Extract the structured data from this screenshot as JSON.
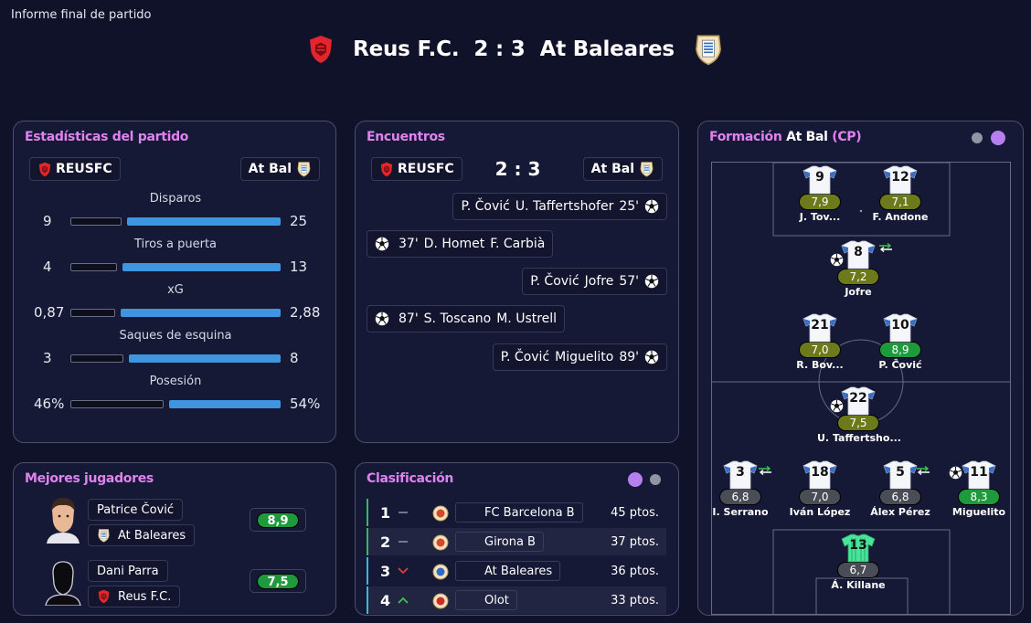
{
  "window_title": "Informe final de partido",
  "header": {
    "home": "Reus F.C.",
    "score": "2 : 3",
    "away": "At Baleares"
  },
  "stats_panel": {
    "title": "Estadísticas del partido",
    "home_chip": "REUSFC",
    "away_chip": "At Bal",
    "stats": [
      {
        "label": "Disparos",
        "home": "9",
        "away": "25",
        "home_share": 0.26
      },
      {
        "label": "Tiros a puerta",
        "home": "4",
        "away": "13",
        "home_share": 0.24
      },
      {
        "label": "xG",
        "home": "0,87",
        "away": "2,88",
        "home_share": 0.23
      },
      {
        "label": "Saques de esquina",
        "home": "3",
        "away": "8",
        "home_share": 0.27
      },
      {
        "label": "Posesión",
        "home": "46%",
        "away": "54%",
        "home_share": 0.46
      }
    ]
  },
  "encounters_panel": {
    "title": "Encuentros",
    "home_chip": "REUSFC",
    "score": "2 : 3",
    "away_chip": "At Bal",
    "events": [
      {
        "side": "away",
        "assist": "P. Čović",
        "scorer": "U. Taffertshofer",
        "minute": "25'"
      },
      {
        "side": "home",
        "minute": "37'",
        "scorer": "D. Homet",
        "assist": "F. Carbià"
      },
      {
        "side": "away",
        "assist": "P. Čović",
        "scorer": "Jofre",
        "minute": "57'"
      },
      {
        "side": "home",
        "minute": "87'",
        "scorer": "S. Toscano",
        "assist": "M. Ustrell"
      },
      {
        "side": "away",
        "assist": "P. Čović",
        "scorer": "Miguelito",
        "minute": "89'"
      }
    ]
  },
  "formation_panel": {
    "title_prefix": "Formación",
    "team": "At Bal",
    "tag": "(CP)",
    "players": [
      {
        "num": "9",
        "rating": "7,9",
        "name": "J. Tov...",
        "tier": "olive"
      },
      {
        "num": "12",
        "rating": "7,1",
        "name": "F. Andone",
        "tier": "olive"
      },
      {
        "num": "8",
        "rating": "7,2",
        "name": "Jofre",
        "tier": "olive"
      },
      {
        "num": "21",
        "rating": "7,0",
        "name": "R. Bov...",
        "tier": "olive"
      },
      {
        "num": "10",
        "rating": "8,9",
        "name": "P. Čović",
        "tier": "green"
      },
      {
        "num": "22",
        "rating": "7,5",
        "name": "U. Taffertsho...",
        "tier": "olive"
      },
      {
        "num": "3",
        "rating": "6,8",
        "name": "I. Serrano",
        "tier": "grey"
      },
      {
        "num": "18",
        "rating": "7,0",
        "name": "Iván López",
        "tier": "grey"
      },
      {
        "num": "5",
        "rating": "6,8",
        "name": "Álex Pérez",
        "tier": "grey"
      },
      {
        "num": "11",
        "rating": "8,3",
        "name": "Miguelito",
        "tier": "green"
      },
      {
        "num": "13",
        "rating": "6,7",
        "name": "Á. Killane",
        "tier": "grey"
      }
    ]
  },
  "best_players_panel": {
    "title": "Mejores jugadores",
    "players": [
      {
        "name": "Patrice Čović",
        "team": "At Baleares",
        "rating": "8,9"
      },
      {
        "name": "Dani Parra",
        "team": "Reus F.C.",
        "rating": "7,5"
      }
    ]
  },
  "standings_panel": {
    "title": "Clasificación",
    "rows": [
      {
        "pos": "1",
        "team": "FC Barcelona B",
        "pts": "45 ptos.",
        "trend": "same"
      },
      {
        "pos": "2",
        "team": "Girona B",
        "pts": "37 ptos.",
        "trend": "same"
      },
      {
        "pos": "3",
        "team": "At Baleares",
        "pts": "36 ptos.",
        "trend": "down"
      },
      {
        "pos": "4",
        "team": "Olot",
        "pts": "33 ptos.",
        "trend": "up"
      }
    ]
  },
  "colors": {
    "accent": "#e182f1",
    "bar": "#3f95de",
    "green_rating": "#1e9a3c",
    "olive_rating": "#6d7a1c",
    "grey_rating": "#4a4c56"
  }
}
